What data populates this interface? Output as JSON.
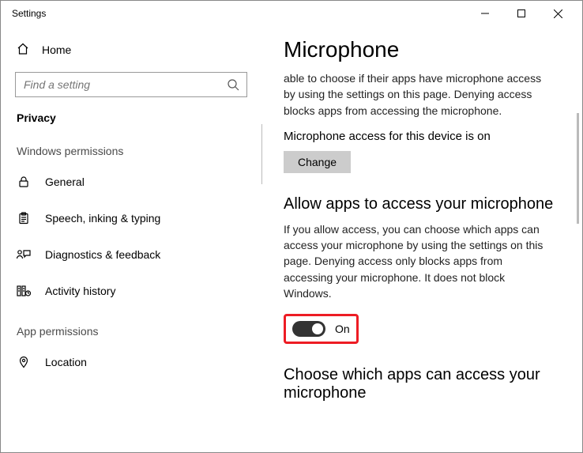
{
  "window": {
    "title": "Settings"
  },
  "sidebar": {
    "home_label": "Home",
    "search_placeholder": "Find a setting",
    "active_section": "Privacy",
    "group1_label": "Windows permissions",
    "items1": [
      {
        "label": "General"
      },
      {
        "label": "Speech, inking & typing"
      },
      {
        "label": "Diagnostics & feedback"
      },
      {
        "label": "Activity history"
      }
    ],
    "group2_label": "App permissions",
    "items2": [
      {
        "label": "Location"
      }
    ]
  },
  "content": {
    "title": "Microphone",
    "intro": "able to choose if their apps have microphone access by using the settings on this page. Denying access blocks apps from accessing the microphone.",
    "access_status": "Microphone access for this device is on",
    "change_label": "Change",
    "allow_heading": "Allow apps to access your microphone",
    "allow_desc": "If you allow access, you can choose which apps can access your microphone by using the settings on this page. Denying access only blocks apps from accessing your microphone. It does not block Windows.",
    "toggle_state_label": "On",
    "choose_heading": "Choose which apps can access your microphone"
  }
}
